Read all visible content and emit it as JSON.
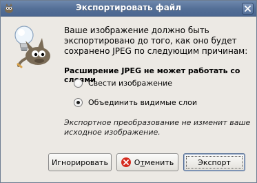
{
  "window": {
    "title": "Экспортировать файл"
  },
  "message": {
    "main": "Ваше изображение должно быть экспортировано до того, как оно будет сохранено JPEG по следующим причинам:",
    "reason": "Расширение JPEG не может работать со слоями",
    "note": "Экспортное преобразование не изменит ваше исходное изображение."
  },
  "options": [
    {
      "label": "Свести изображение",
      "checked": false
    },
    {
      "label": "Объединить видимые слои",
      "checked": true
    }
  ],
  "buttons": {
    "ignore": "Игнорировать",
    "cancel_prefix": "О",
    "cancel_mnemonic": "т",
    "cancel_suffix": "менить",
    "export": "Экспорт"
  },
  "colors": {
    "titlebar": "#536e96",
    "window_bg": "#ece9e4",
    "cancel_icon": "#d52b1e"
  },
  "icons": {
    "window": "gimp-wilber-icon",
    "close": "close-icon",
    "dialog": "gimp-tip-lightbulb-icon",
    "cancel": "cancel-icon"
  }
}
